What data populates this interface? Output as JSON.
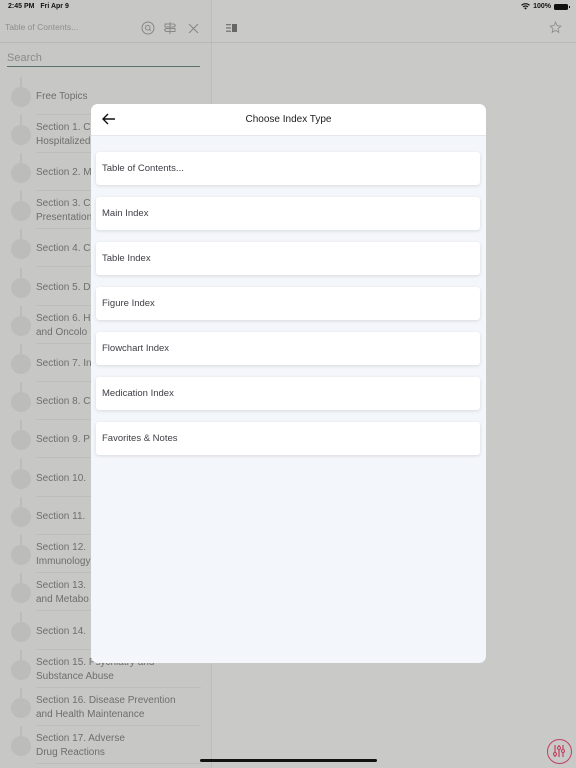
{
  "status_bar": {
    "time": "2:45 PM",
    "date": "Fri Apr 9",
    "battery": "100%"
  },
  "sidebar": {
    "toc_field": "Table of Contents...",
    "search_placeholder": "Search",
    "items": [
      {
        "label": "Free Topics"
      },
      {
        "label": "Section 1. C\nHospitalized"
      },
      {
        "label": "Section 2. M"
      },
      {
        "label": "Section 3. C\nPresentation"
      },
      {
        "label": "Section 4. C"
      },
      {
        "label": "Section 5. D"
      },
      {
        "label": "Section 6. H\nand  Oncolo"
      },
      {
        "label": "Section 7. In"
      },
      {
        "label": "Section 8. C"
      },
      {
        "label": "Section 9. P"
      },
      {
        "label": "Section 10."
      },
      {
        "label": "Section 11."
      },
      {
        "label": "Section 12.\nImmunology"
      },
      {
        "label": "Section 13.\nand  Metabo"
      },
      {
        "label": "Section 14."
      },
      {
        "label": "Section 15. Psychiatry and\nSubstance Abuse"
      },
      {
        "label": "Section 16. Disease Prevention\nand  Health Maintenance"
      },
      {
        "label": "Section 17. Adverse\nDrug Reactions"
      }
    ]
  },
  "modal": {
    "title": "Choose Index Type",
    "options": [
      {
        "label": "Table of Contents..."
      },
      {
        "label": "Main Index"
      },
      {
        "label": "Table Index"
      },
      {
        "label": "Figure Index"
      },
      {
        "label": "Flowchart Index"
      },
      {
        "label": "Medication Index"
      },
      {
        "label": "Favorites & Notes"
      }
    ]
  },
  "colors": {
    "accent": "#c2405e",
    "search_underline": "#5b7272"
  }
}
